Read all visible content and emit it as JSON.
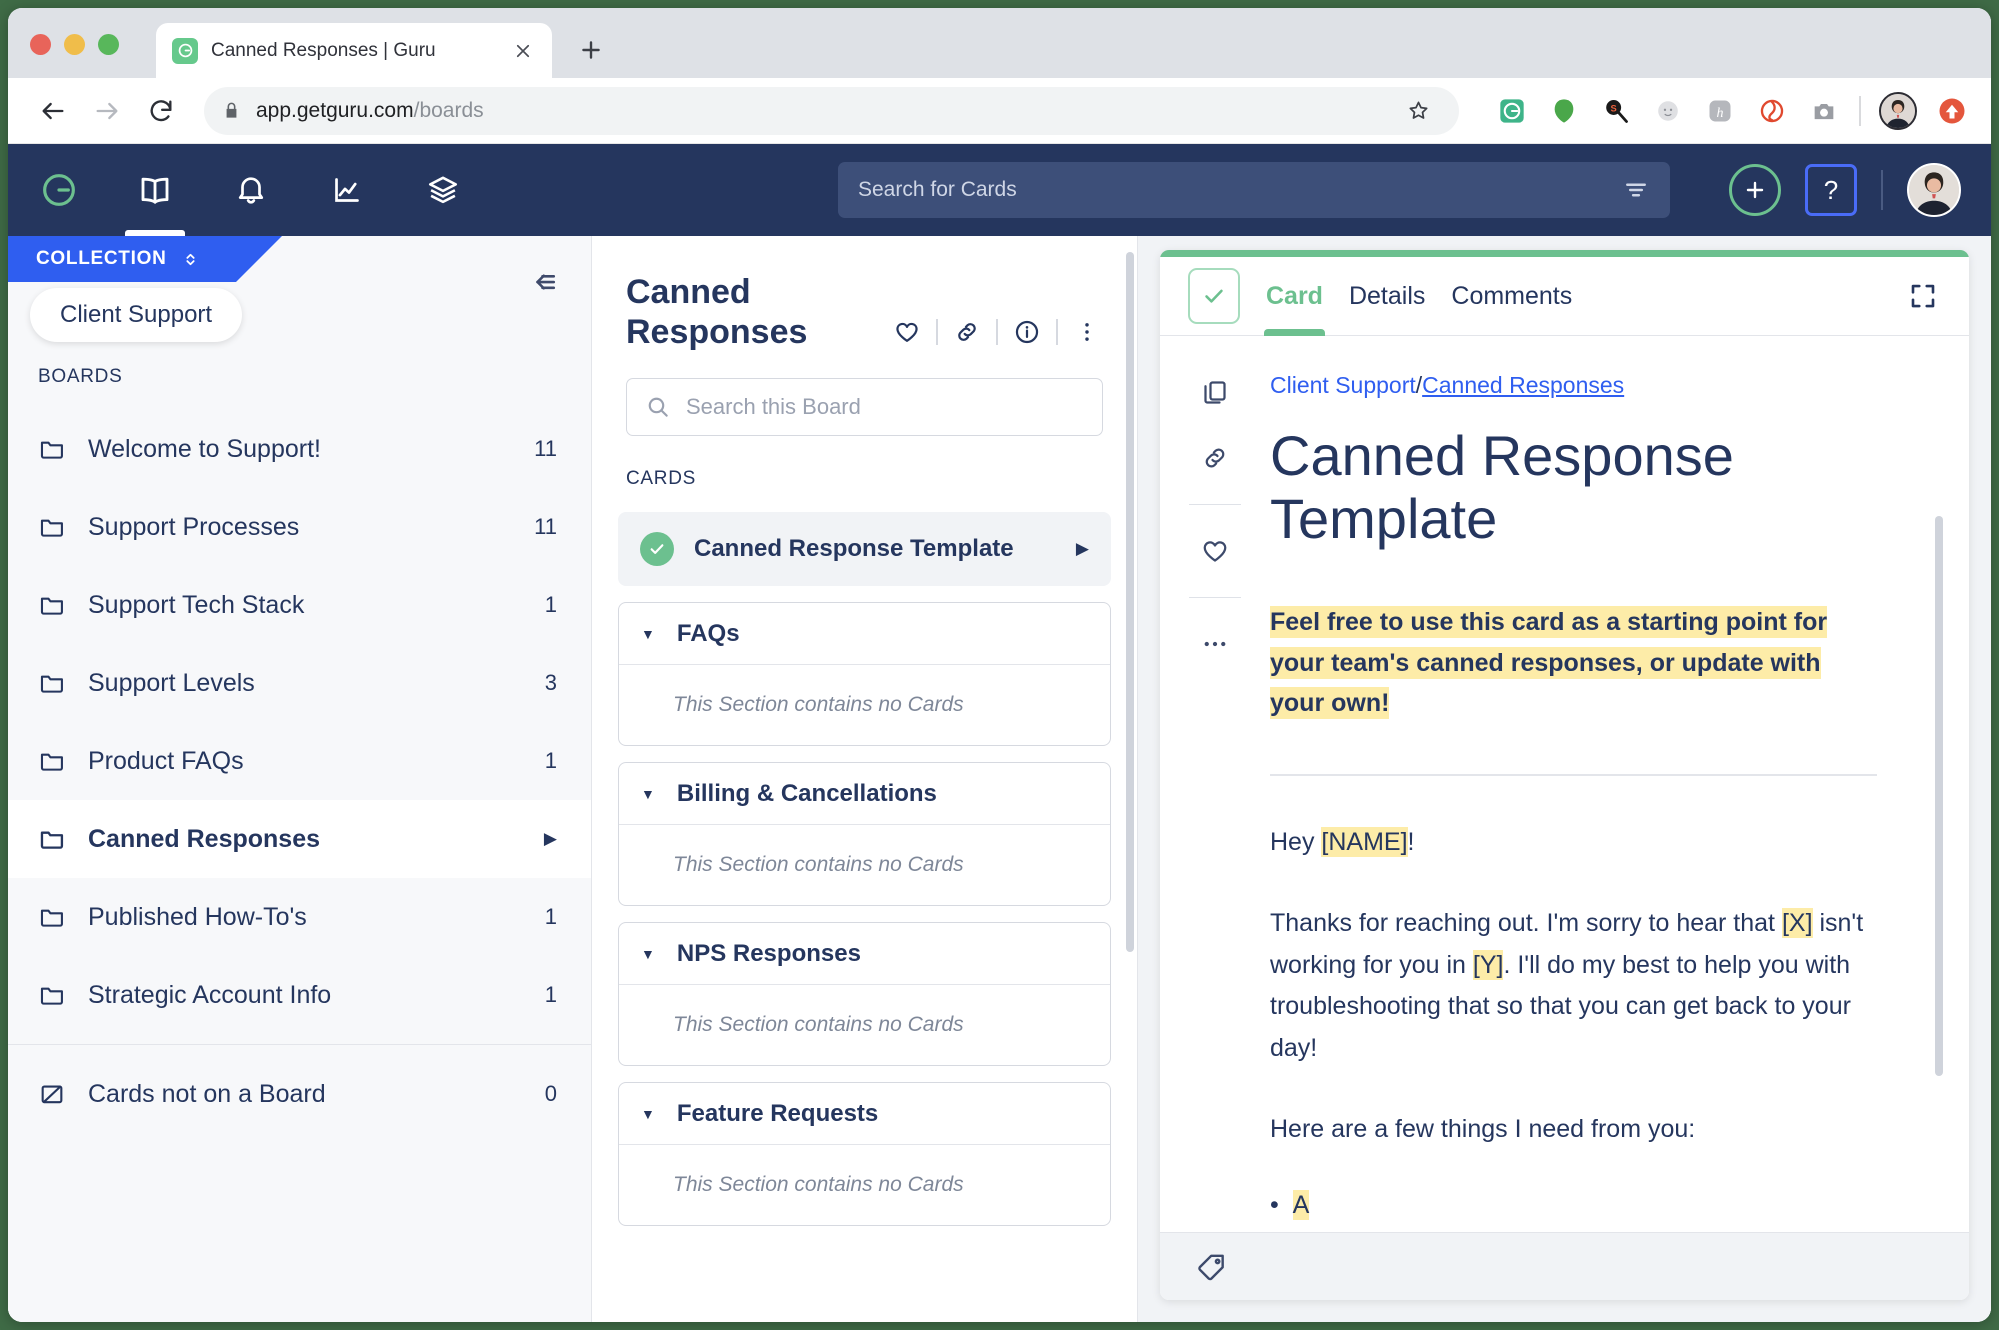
{
  "browser": {
    "tab": {
      "title": "Canned Responses | Guru",
      "favicon": "guru-logo-icon",
      "close": "close-icon"
    },
    "new_tab": "new-tab-icon",
    "back": "back-arrow-icon",
    "forward": "forward-arrow-icon",
    "reload": "reload-icon",
    "lock": "lock-icon",
    "url_host": "app.getguru.com",
    "url_path": "/boards",
    "bookmark": "star-icon",
    "extensions": [
      "grammarly-icon",
      "evernote-icon",
      "search-magnifier-icon",
      "moon-face-icon",
      "honey-icon",
      "loom-icon",
      "screenshot-camera-icon"
    ],
    "profile_avatar": "browser-profile-avatar",
    "update_badge": "update-arrow-icon"
  },
  "appnav": {
    "logo": "guru-logo-icon",
    "items": [
      {
        "name": "book-icon",
        "active": true
      },
      {
        "name": "bell-icon",
        "active": false
      },
      {
        "name": "analytics-chart-icon",
        "active": false
      },
      {
        "name": "layers-icon",
        "active": false
      }
    ],
    "search_placeholder": "Search for Cards",
    "filter_icon": "filter-icon",
    "add_label": "+",
    "help_label": "?",
    "avatar": "user-avatar"
  },
  "sidebar": {
    "collection_label": "COLLECTION",
    "collection_switch_icon": "chevron-updown-icon",
    "collection_name": "Client Support",
    "collapse_icon": "collapse-sidebar-icon",
    "boards_label": "BOARDS",
    "boards": [
      {
        "name": "Welcome to Support!",
        "count": "11",
        "selected": false
      },
      {
        "name": "Support Processes",
        "count": "11",
        "selected": false
      },
      {
        "name": "Support Tech Stack",
        "count": "1",
        "selected": false
      },
      {
        "name": "Support Levels",
        "count": "3",
        "selected": false
      },
      {
        "name": "Product FAQs",
        "count": "1",
        "selected": false
      },
      {
        "name": "Canned Responses",
        "count": "",
        "selected": true
      },
      {
        "name": "Published How-To's",
        "count": "1",
        "selected": false
      },
      {
        "name": "Strategic Account Info",
        "count": "1",
        "selected": false
      }
    ],
    "unassigned": {
      "name": "Cards not on a Board",
      "count": "0",
      "icon": "folder-slash-icon"
    }
  },
  "board": {
    "title": "Canned Responses",
    "actions": [
      {
        "name": "favorite-heart-icon"
      },
      {
        "name": "copy-link-icon"
      },
      {
        "name": "info-icon"
      },
      {
        "name": "more-options-icon"
      }
    ],
    "search_placeholder": "Search this Board",
    "cards_label": "CARDS",
    "card": {
      "name": "Canned Response Template",
      "verified": true
    },
    "sections": [
      {
        "name": "FAQs",
        "empty_text": "This Section contains no Cards"
      },
      {
        "name": "Billing & Cancellations",
        "empty_text": "This Section contains no Cards"
      },
      {
        "name": "NPS Responses",
        "empty_text": "This Section contains no Cards"
      },
      {
        "name": "Feature Requests",
        "empty_text": "This Section contains no Cards"
      }
    ]
  },
  "card_panel": {
    "verify_icon": "verified-check-icon",
    "tabs": [
      {
        "label": "Card",
        "active": true
      },
      {
        "label": "Details",
        "active": false
      },
      {
        "label": "Comments",
        "active": false
      }
    ],
    "expand_icon": "expand-fullscreen-icon",
    "rail": [
      "duplicate-card-icon",
      "copy-link-icon",
      "favorite-heart-icon",
      "more-options-icon"
    ],
    "breadcrumb": {
      "collection": "Client Support",
      "separator": "/",
      "board": "Canned Responses"
    },
    "title": "Canned Response Template",
    "intro": "Feel free to use this card as a starting point for your team's canned responses, or update with your own!",
    "greeting_prefix": "Hey ",
    "greeting_token": "[NAME]",
    "greeting_suffix": "!",
    "paragraph_1a": "Thanks for reaching out. I'm sorry to hear that ",
    "paragraph_1_token_x": "[X]",
    "paragraph_1b": " isn't working for you in ",
    "paragraph_1_token_y": "[Y]",
    "paragraph_1c": ". I'll do my best to help you with troubleshooting that so that you can get back to your day!",
    "paragraph_2": "Here are a few things I need from you:",
    "footer_icon": "tag-icon"
  },
  "colors": {
    "nav_bg": "#25365e",
    "accent_green": "#6cc08f",
    "accent_blue": "#2f5ef0",
    "highlight_yellow": "#fdeca8",
    "text_navy": "#25365e"
  }
}
